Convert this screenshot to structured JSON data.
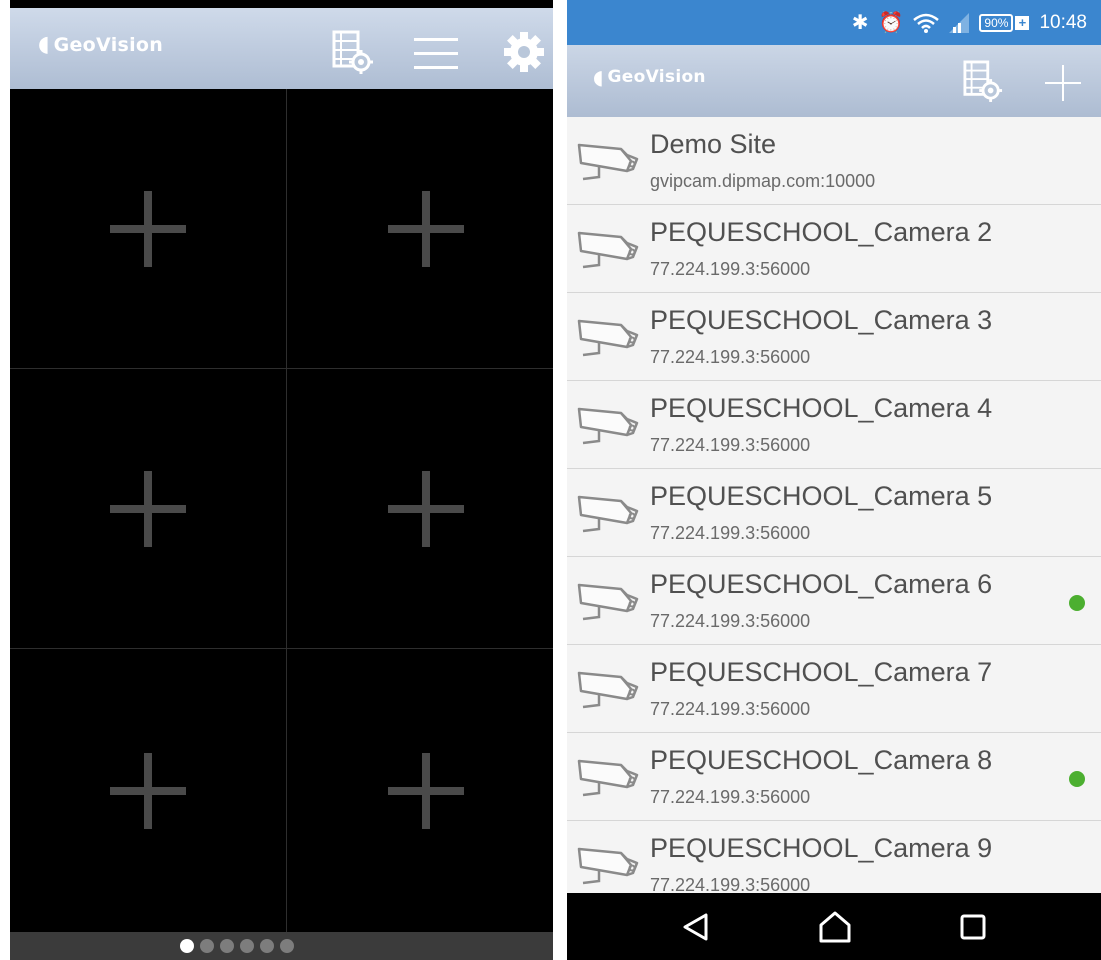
{
  "left": {
    "logo": "GeoVision",
    "icons": [
      "layout-settings-icon",
      "menu-icon",
      "gear-icon"
    ],
    "grid": {
      "cells": [
        {
          "icon": "plus-icon"
        },
        {
          "icon": "plus-icon"
        },
        {
          "icon": "plus-icon"
        },
        {
          "icon": "plus-icon"
        },
        {
          "icon": "plus-icon"
        },
        {
          "icon": "plus-icon"
        }
      ]
    },
    "pager": {
      "pages": 6,
      "active_page": 1
    }
  },
  "right": {
    "status_bar": {
      "icons": [
        "bluetooth-icon",
        "alarm-icon",
        "wifi-icon",
        "signal-icon",
        "battery-icon"
      ],
      "battery": "90%",
      "time": "10:48"
    },
    "logo": "GeoVision",
    "icons": [
      "layout-settings-icon",
      "add-icon"
    ],
    "sites": [
      {
        "name": "Demo Site",
        "address": "gvipcam.dipmap.com:10000",
        "online": false
      },
      {
        "name": "PEQUESCHOOL_Camera 2",
        "address": "77.224.199.3:56000",
        "online": false
      },
      {
        "name": "PEQUESCHOOL_Camera 3",
        "address": "77.224.199.3:56000",
        "online": false
      },
      {
        "name": "PEQUESCHOOL_Camera 4",
        "address": "77.224.199.3:56000",
        "online": false
      },
      {
        "name": "PEQUESCHOOL_Camera 5",
        "address": "77.224.199.3:56000",
        "online": false
      },
      {
        "name": "PEQUESCHOOL_Camera 6",
        "address": "77.224.199.3:56000",
        "online": true
      },
      {
        "name": "PEQUESCHOOL_Camera 7",
        "address": "77.224.199.3:56000",
        "online": false
      },
      {
        "name": "PEQUESCHOOL_Camera 8",
        "address": "77.224.199.3:56000",
        "online": true
      },
      {
        "name": "PEQUESCHOOL_Camera 9",
        "address": "77.224.199.3:56000",
        "online": false
      }
    ],
    "nav_bar": [
      "back-icon",
      "home-icon",
      "recents-icon"
    ]
  },
  "colors": {
    "status_bar": "#3b86cf",
    "app_bar": "#b8c6da",
    "online": "#4caf30",
    "grid_bg": "#000000"
  }
}
